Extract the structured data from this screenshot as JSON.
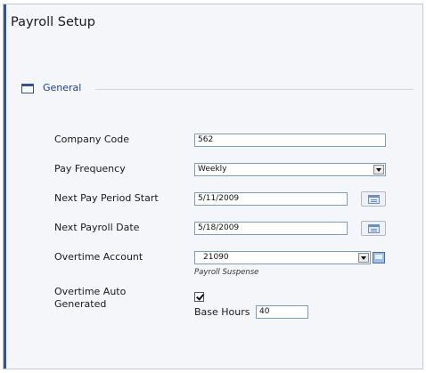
{
  "page": {
    "title": "Payroll Setup"
  },
  "section": {
    "label": "General",
    "icon": "panel-icon",
    "label_color": "#1a3fb0"
  },
  "form": {
    "company_code": {
      "label": "Company Code",
      "value": "562"
    },
    "pay_frequency": {
      "label": "Pay Frequency",
      "value": "Weekly"
    },
    "next_pay_period_start": {
      "label": "Next Pay Period Start",
      "value": "5/11/2009"
    },
    "next_payroll_date": {
      "label": "Next Payroll Date",
      "value": "5/18/2009"
    },
    "overtime_account": {
      "label": "Overtime Account",
      "value": "21090",
      "description": "Payroll Suspense"
    },
    "overtime_auto_generated": {
      "label_line1": "Overtime Auto",
      "label_line2": "Generated",
      "checked": true
    },
    "base_hours": {
      "label": "Base Hours",
      "value": "40"
    }
  },
  "colors": {
    "accent": "#2f5597",
    "panel_bg": "#f5f6f9",
    "input_border": "#7f9db9"
  }
}
